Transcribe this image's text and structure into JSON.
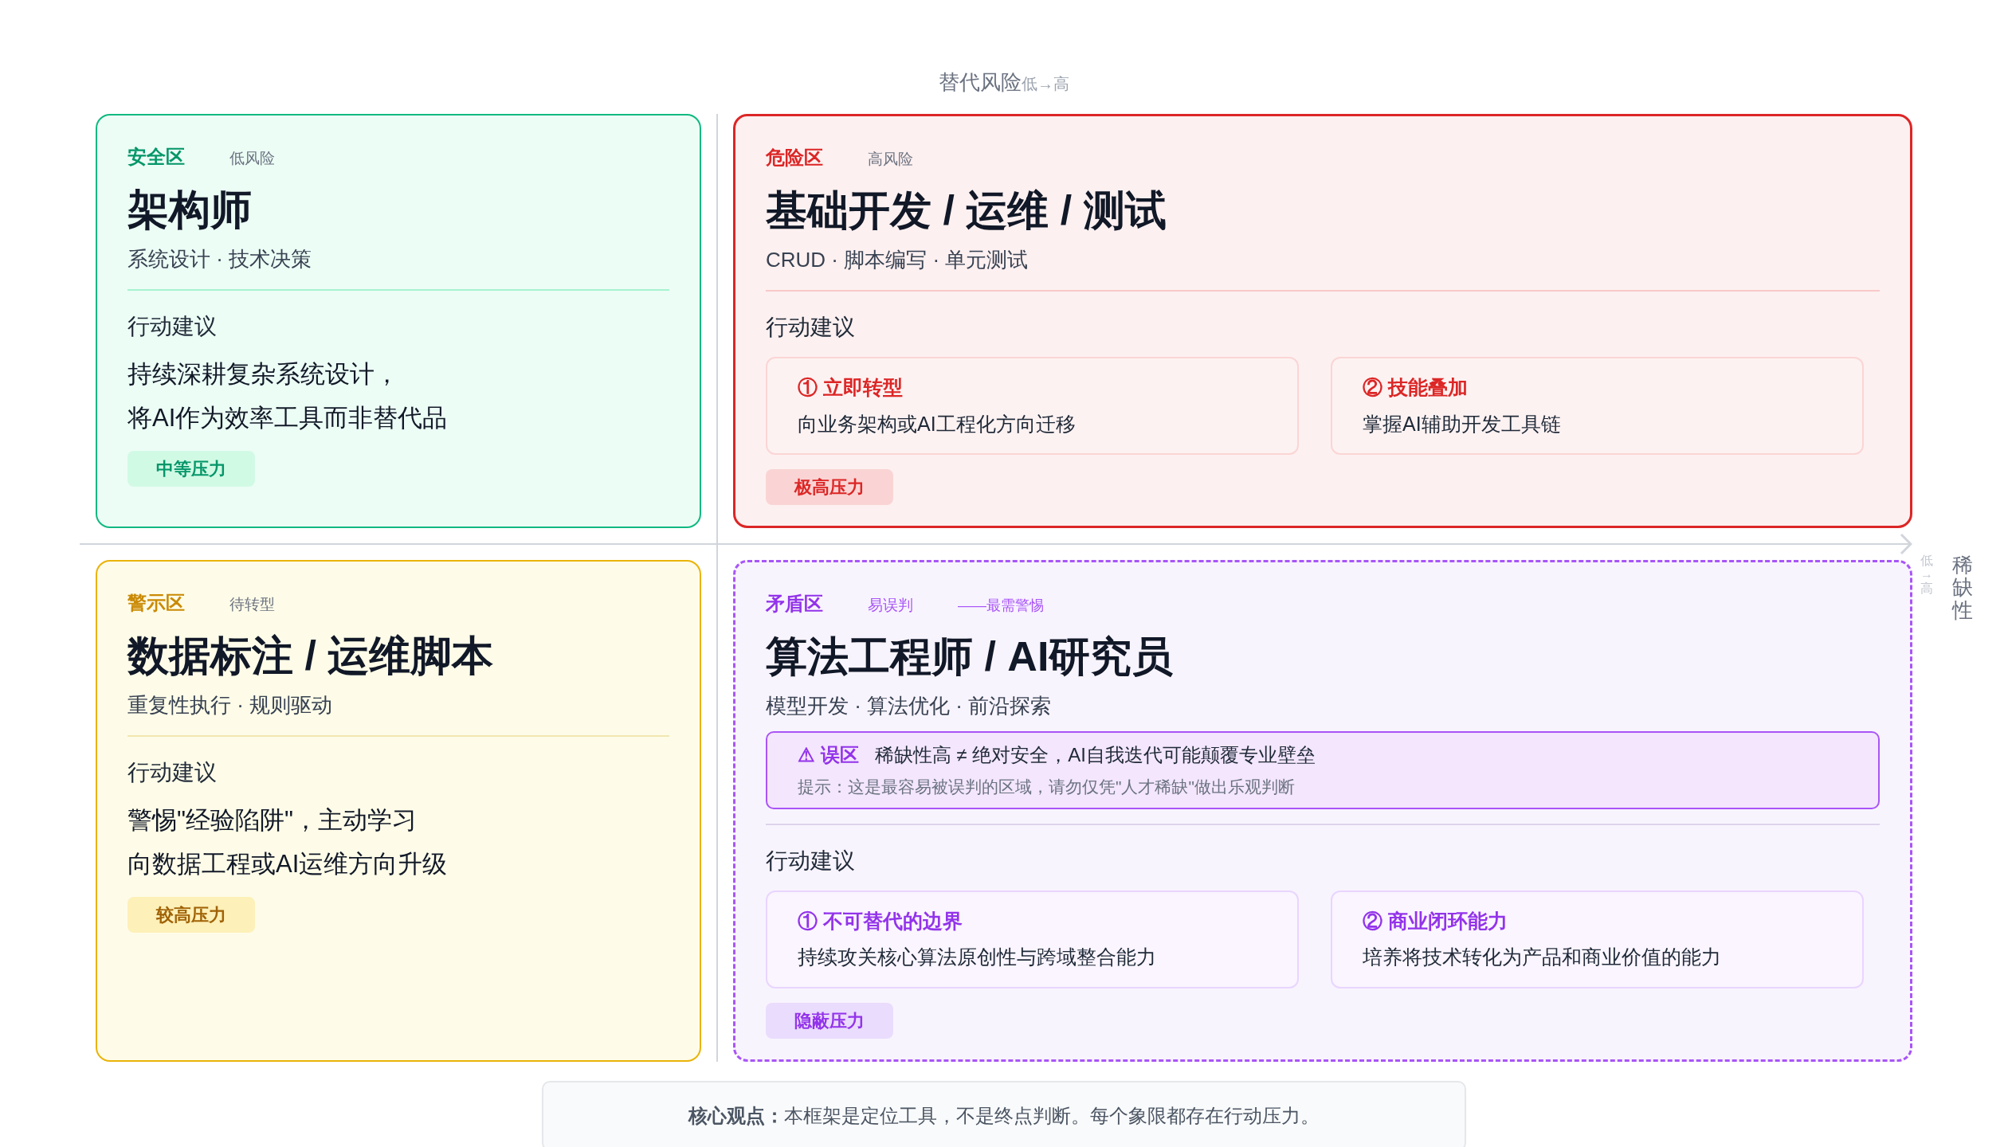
{
  "axis_top": {
    "label": "替代风险",
    "range": "低→高"
  },
  "axis_right": {
    "label": "稀缺性",
    "range": "低→高"
  },
  "quadrants": [
    {
      "kind": "safe",
      "zone": "安全区",
      "risk": "低风险",
      "title": "架构师",
      "subtitle": "系统设计 · 技术决策",
      "section": "行动建议",
      "advice": [
        "持续深耕复杂系统设计，",
        "将AI作为效率工具而非替代品"
      ],
      "pressure": "中等压力"
    },
    {
      "kind": "danger",
      "zone": "危险区",
      "risk": "高风险",
      "title": "基础开发 / 运维 / 测试",
      "subtitle": "CRUD · 脚本编写 · 单元测试",
      "section": "行动建议",
      "actions": [
        {
          "title": "① 立即转型",
          "text": "向业务架构或AI工程化方向迁移"
        },
        {
          "title": "② 技能叠加",
          "text": "掌握AI辅助开发工具链"
        }
      ],
      "pressure": "极高压力"
    },
    {
      "kind": "warn",
      "zone": "警示区",
      "risk": "待转型",
      "title": "数据标注 / 运维脚本",
      "subtitle": "重复性执行 · 规则驱动",
      "section": "行动建议",
      "advice": [
        "警惕\"经验陷阱\"，主动学习",
        "向数据工程或AI运维方向升级"
      ],
      "pressure": "较高压力"
    },
    {
      "kind": "paradox",
      "zone": "矛盾区",
      "risk": "易误判",
      "note": "——最需警惕",
      "title": "算法工程师 / AI研究员",
      "subtitle": "模型开发 · 算法优化 · 前沿探索",
      "warning": {
        "tag": "⚠ 误区",
        "text": "稀缺性高 ≠ 绝对安全，AI自我迭代可能颠覆专业壁垒",
        "hint": "提示：这是最容易被误判的区域，请勿仅凭\"人才稀缺\"做出乐观判断"
      },
      "section": "行动建议",
      "actions": [
        {
          "title": "① 不可替代的边界",
          "text": "持续攻关核心算法原创性与跨域整合能力"
        },
        {
          "title": "② 商业闭环能力",
          "text": "培养将技术转化为产品和商业价值的能力"
        }
      ],
      "pressure": "隐蔽压力"
    }
  ],
  "footer": "**核心观点：**本框架是定位工具，不是终点判断。每个象限都存在行动压力。"
}
